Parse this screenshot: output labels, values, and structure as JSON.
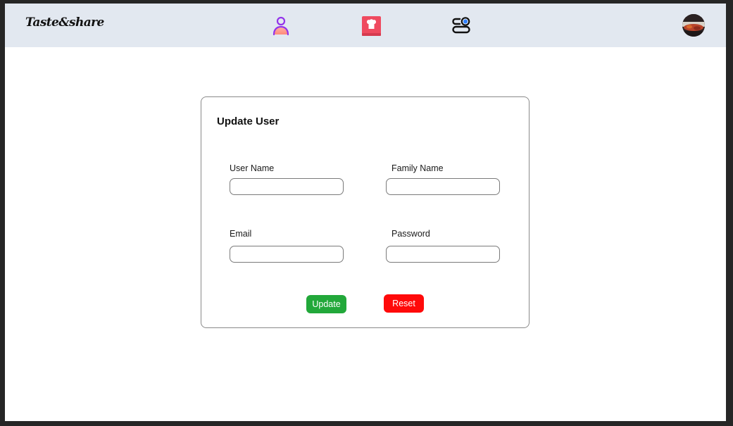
{
  "brand": {
    "name": "Taste&share"
  },
  "nav": {
    "items": [
      {
        "icon": "user-icon",
        "color": "#9333ea"
      },
      {
        "icon": "recipe-book-icon",
        "color": "#ef4a5f"
      },
      {
        "icon": "settings-toggle-icon",
        "color": "#111111"
      }
    ],
    "avatar": {
      "icon": "avatar-icon"
    }
  },
  "form": {
    "title": "Update User",
    "fields": {
      "user_name": {
        "label": "User Name",
        "value": "",
        "placeholder": ""
      },
      "family_name": {
        "label": "Family Name",
        "value": "",
        "placeholder": ""
      },
      "email": {
        "label": "Email",
        "value": "",
        "placeholder": ""
      },
      "password": {
        "label": "Password",
        "value": "",
        "placeholder": ""
      }
    },
    "buttons": {
      "update": "Update",
      "reset": "Reset"
    }
  },
  "colors": {
    "topbar": "#e2e8f0",
    "update_button": "#22a83a",
    "reset_button": "#ff0a0a"
  }
}
